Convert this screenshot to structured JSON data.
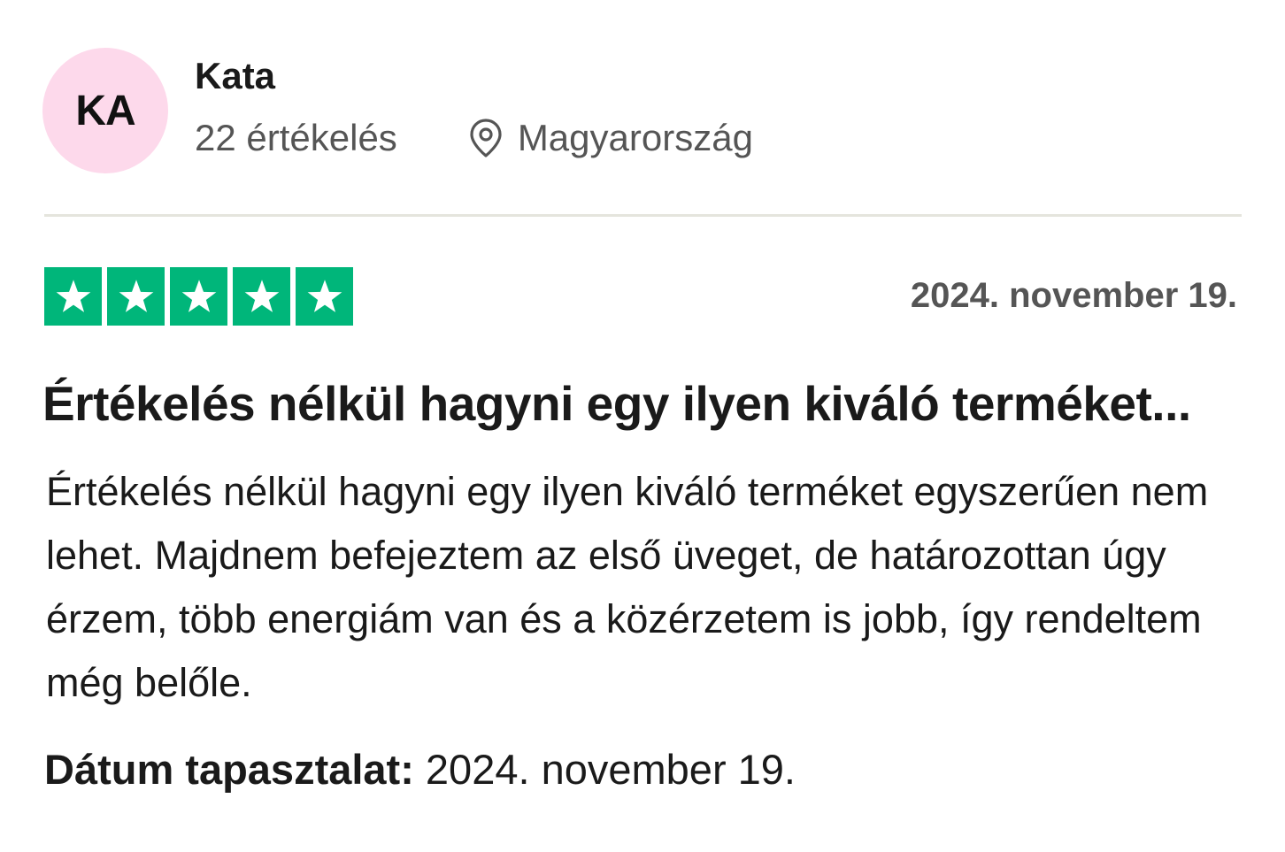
{
  "reviewer": {
    "initials": "KA",
    "name": "Kata",
    "review_count": "22 értékelés",
    "location": "Magyarország",
    "avatar_color": "#fdd9eb"
  },
  "review": {
    "rating": 5,
    "rating_max": 5,
    "star_color": "#00b67a",
    "date": "2024. november 19.",
    "title": "Értékelés nélkül hagyni egy ilyen kiváló terméket...",
    "body": "Értékelés nélkül hagyni egy ilyen kiváló terméket egyszerűen nem lehet. Majdnem befejeztem az első üveget, de határozottan úgy érzem, több energiám van és a közérzetem is jobb, így rendeltem még belőle.",
    "experience_label": "Dátum tapasztalat:",
    "experience_date": "2024. november 19."
  },
  "icons": {
    "location": "map-pin-icon",
    "star": "star-icon"
  }
}
